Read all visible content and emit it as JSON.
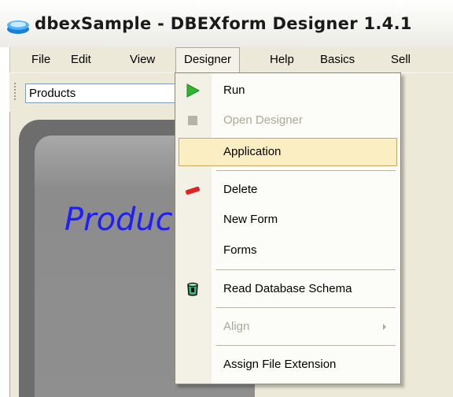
{
  "window": {
    "title": "dbexSample - DBEXform Designer 1.4.1"
  },
  "menubar": {
    "items": [
      "File",
      "Edit",
      "View",
      "Designer",
      "Help",
      "Basics",
      "Sell"
    ],
    "active": "Designer"
  },
  "toolbar": {
    "form_selector_value": "Products"
  },
  "form_preview": {
    "title_text": "Produc"
  },
  "designer_menu": {
    "items": [
      {
        "label": "Run",
        "icon": "play-icon",
        "enabled": true
      },
      {
        "label": "Open Designer",
        "icon": "stop-icon",
        "enabled": false
      },
      {
        "label": "Application",
        "enabled": true,
        "highlighted": true
      },
      {
        "label": "Delete",
        "icon": "delete-icon",
        "enabled": true
      },
      {
        "label": "New Form",
        "enabled": true
      },
      {
        "label": "Forms",
        "enabled": true
      },
      {
        "label": "Read Database Schema",
        "icon": "database-icon",
        "enabled": true
      },
      {
        "label": "Align",
        "enabled": false,
        "submenu": true
      },
      {
        "label": "Assign File Extension",
        "enabled": true
      }
    ]
  },
  "colors": {
    "accent_highlight": "#fbeec3",
    "form_title_color": "#1d1dff",
    "run_icon": "#2fb62f"
  }
}
